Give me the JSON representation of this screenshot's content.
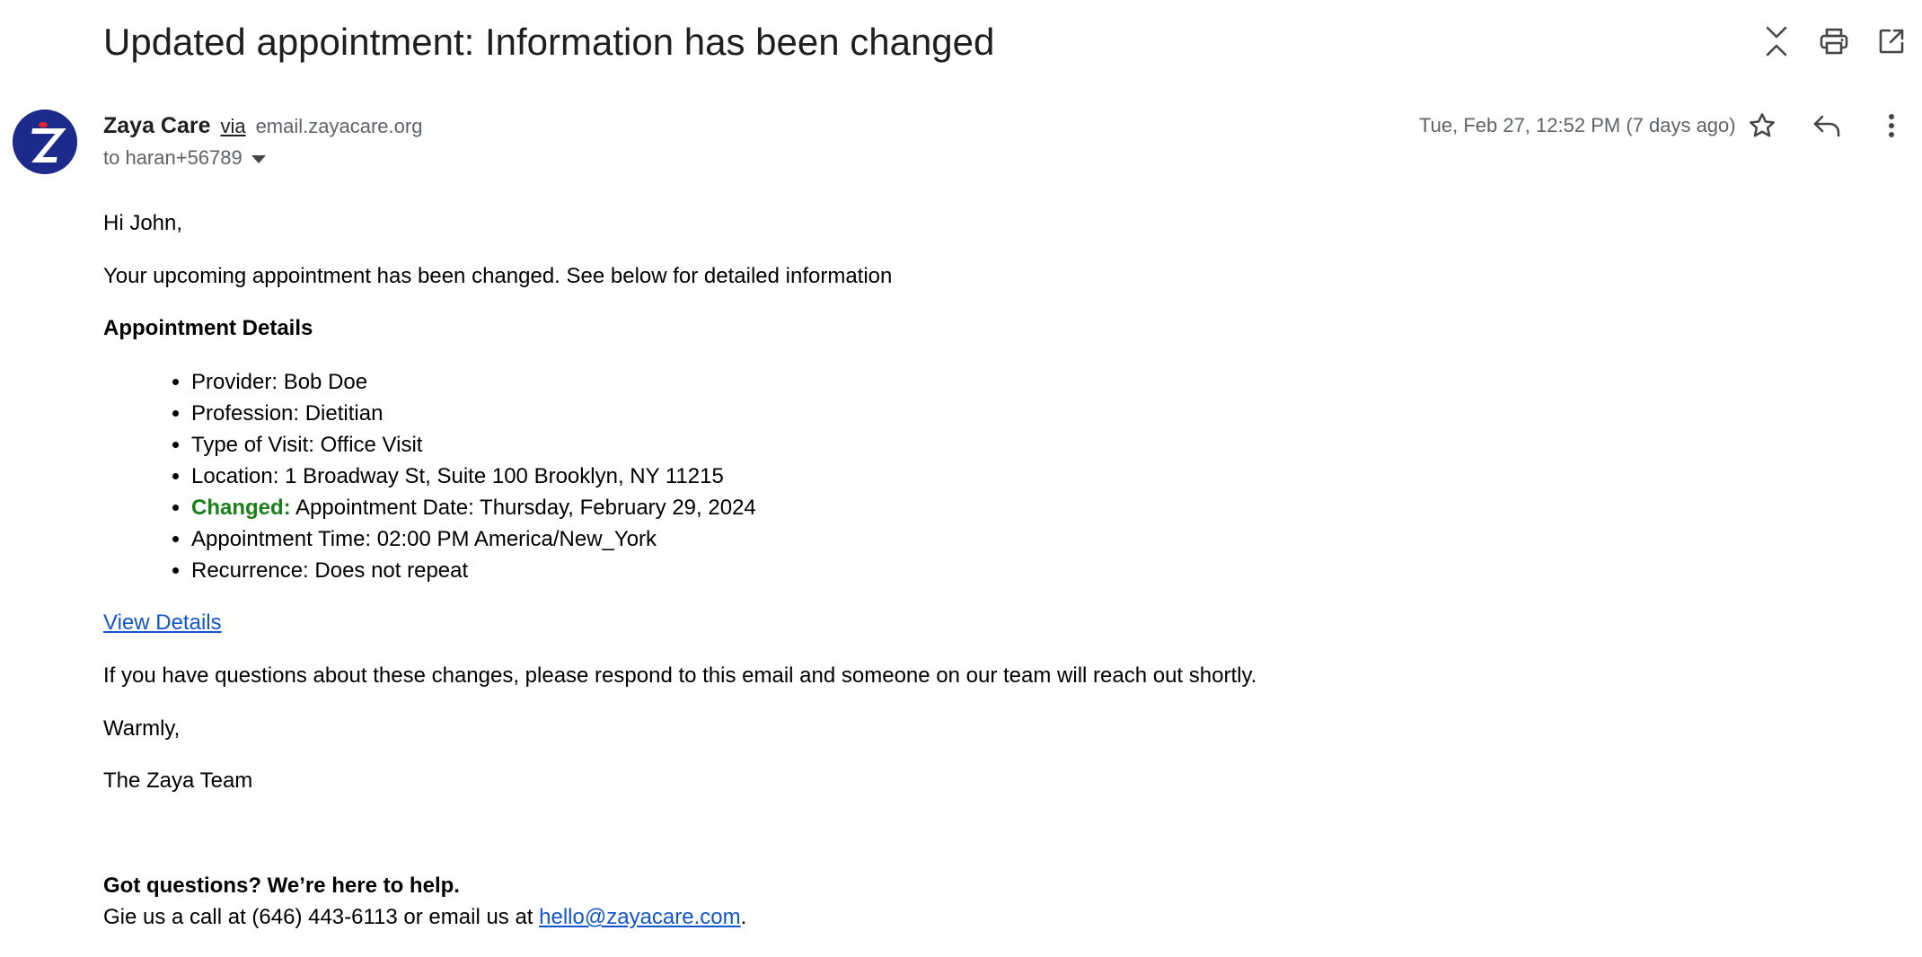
{
  "email": {
    "subject": "Updated appointment: Information has been changed",
    "sender": {
      "name": "Zaya Care",
      "via_label": "via",
      "domain": "email.zayacare.org",
      "avatar_letter": "Z"
    },
    "recipient": "to haran+56789",
    "date": "Tue, Feb 27, 12:52 PM (7 days ago)"
  },
  "body": {
    "greeting": "Hi John,",
    "intro": "Your upcoming appointment has been changed. See below for detailed information",
    "details_heading": "Appointment Details",
    "details": [
      {
        "text": "Provider: Bob Doe"
      },
      {
        "text": "Profession: Dietitian"
      },
      {
        "text": "Type of Visit: Office Visit"
      },
      {
        "text": "Location: 1 Broadway St, Suite 100 Brooklyn, NY 11215"
      },
      {
        "changed_label": "Changed:",
        "text": "Appointment Date: Thursday, February 29, 2024"
      },
      {
        "text": "Appointment Time: 02:00 PM America/New_York"
      },
      {
        "text": "Recurrence: Does not repeat"
      }
    ],
    "view_details_link": "View Details",
    "questions_text": "If you have questions about these changes, please respond to this email and someone on our team will reach out shortly.",
    "signoff": "Warmly,",
    "team": "The Zaya Team",
    "footer_heading": "Got questions? We’re here to help.",
    "footer_text": "Gie us a call at (646) 443-6113 or email us at",
    "footer_email": "hello@zayacare.com",
    "footer_period": "."
  },
  "icons": {
    "top": [
      "collapse-icon",
      "print-icon",
      "open-in-new-window-icon"
    ],
    "message": [
      "star-icon",
      "reply-icon",
      "more-vert-icon"
    ]
  },
  "colors": {
    "changed": "#1a7f1a",
    "link": "#1155cc",
    "avatar_bg": "#1c2a8c",
    "avatar_accent": "#e0262f"
  }
}
